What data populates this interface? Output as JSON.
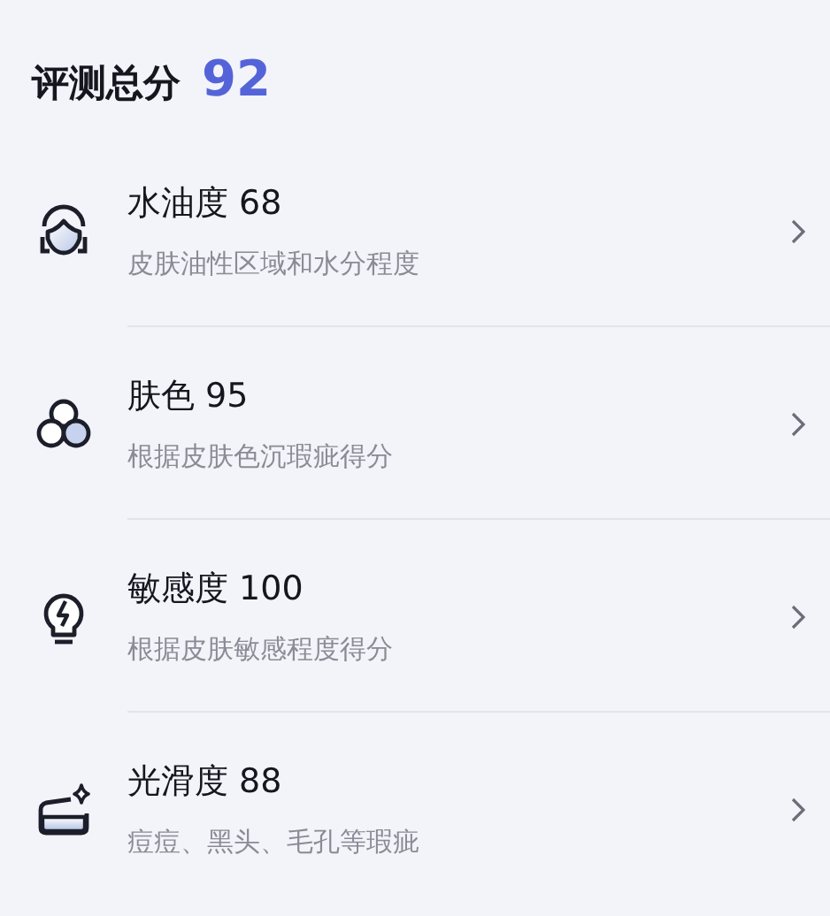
{
  "header": {
    "label": "评测总分",
    "score": "92"
  },
  "items": [
    {
      "kind": "face",
      "title": "水油度 68",
      "description": "皮肤油性区域和水分程度"
    },
    {
      "kind": "circles",
      "title": "肤色 95",
      "description": "根据皮肤色沉瑕疵得分"
    },
    {
      "kind": "bulb",
      "title": "敏感度 100",
      "description": "根据皮肤敏感程度得分"
    },
    {
      "kind": "smooth",
      "title": "光滑度 88",
      "description": "痘痘、黑头、毛孔等瑕疵"
    }
  ]
}
